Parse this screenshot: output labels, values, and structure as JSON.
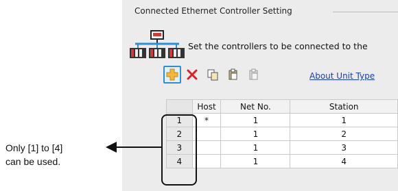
{
  "group": {
    "title": "Connected Ethernet Controller Setting"
  },
  "description": "Set the controllers to be connected to the",
  "toolbar": {
    "buttons": [
      {
        "name": "add-icon"
      },
      {
        "name": "delete-icon"
      },
      {
        "name": "copy-icon"
      },
      {
        "name": "paste-icon"
      },
      {
        "name": "paste-disabled-icon"
      }
    ],
    "link": "About Unit Type"
  },
  "table": {
    "columns": [
      "",
      "Host",
      "Net No.",
      "Station"
    ],
    "rows": [
      {
        "num": "1",
        "host": "*",
        "net": "1",
        "station": "1"
      },
      {
        "num": "2",
        "host": "",
        "net": "1",
        "station": "2"
      },
      {
        "num": "3",
        "host": "",
        "net": "1",
        "station": "3"
      },
      {
        "num": "4",
        "host": "",
        "net": "1",
        "station": "4"
      }
    ]
  },
  "callout": {
    "line1": "Only [1] to [4]",
    "line2": "can be used."
  },
  "colors": {
    "accent": "#2b8fd8",
    "link": "#1a3ea8",
    "delete": "#e02020"
  }
}
